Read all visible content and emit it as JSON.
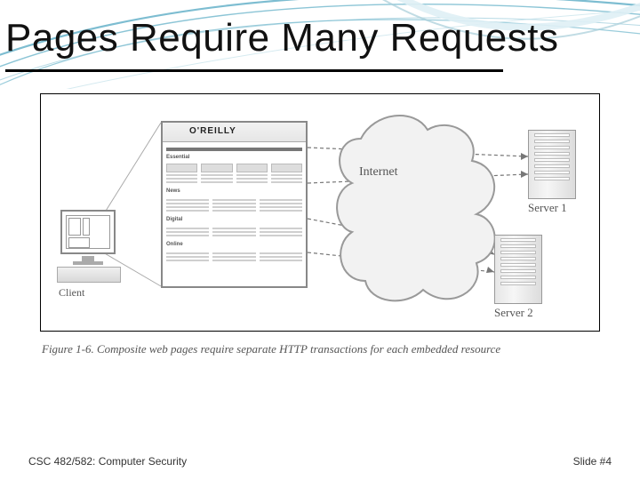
{
  "title": "Pages Require Many Requests",
  "figure": {
    "browser_logo": "O'REILLY",
    "client_label": "Client",
    "cloud_label": "Internet",
    "server1_label": "Server 1",
    "server2_label": "Server 2",
    "browser_sections": {
      "s1": "Essential",
      "s2": "News",
      "s3": "Digital",
      "s4": "Online"
    },
    "caption": "Figure 1-6. Composite web pages require separate HTTP transactions for each embedded resource"
  },
  "footer": {
    "course": "CSC 482/582: Computer Security",
    "slide": "Slide #4"
  }
}
